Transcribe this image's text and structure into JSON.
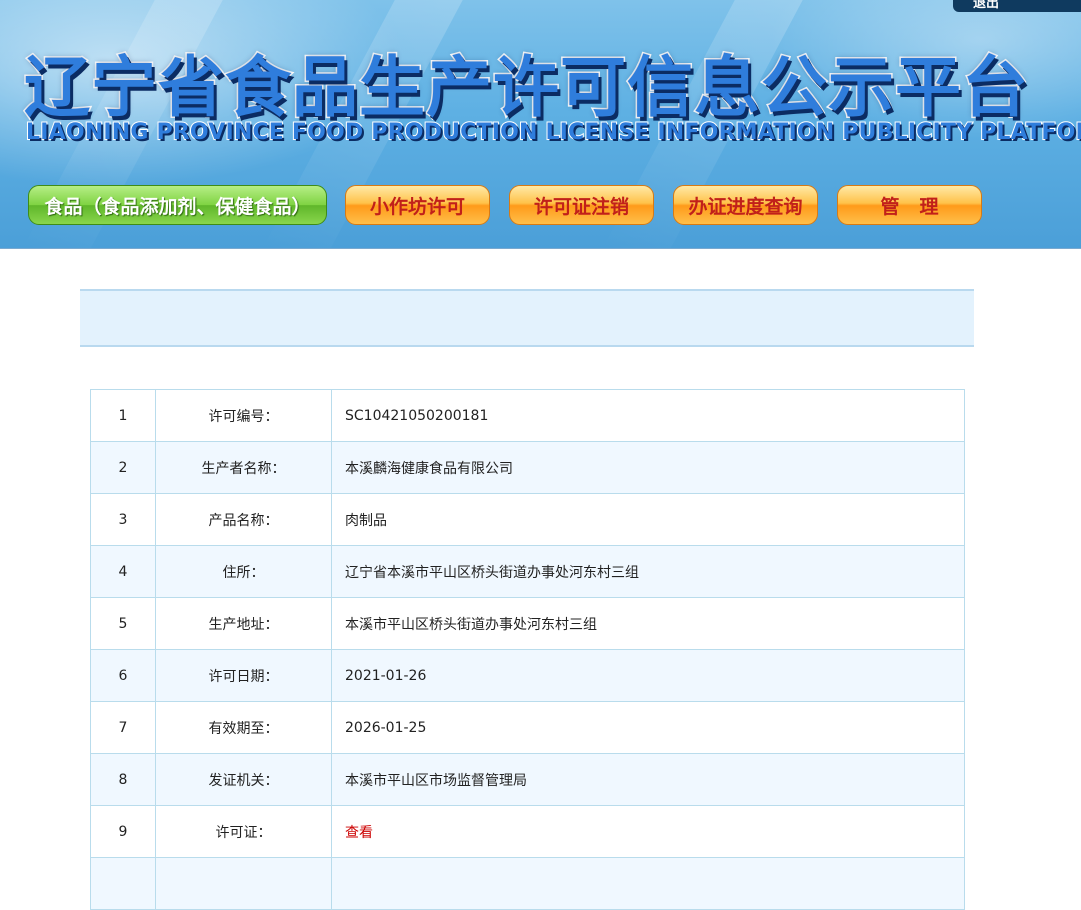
{
  "header": {
    "corner_text": "退出",
    "title": "辽宁省食品生产许可信息公示平台",
    "subtitle": "LIAONING PROVINCE FOOD PRODUCTION LICENSE INFORMATION PUBLICITY PLATFORM"
  },
  "nav": [
    {
      "label": "食品（食品添加剂、保健食品）"
    },
    {
      "label": "小作坊许可"
    },
    {
      "label": "许可证注销"
    },
    {
      "label": "办证进度查询"
    },
    {
      "label": "管理"
    }
  ],
  "colors": {
    "banner": "#5eb0e3",
    "nav_green": "#7fd342",
    "nav_orange": "#ffb233",
    "nav_orange_text": "#c1201a",
    "info_bar": "#e3f2fd",
    "table_border": "#b9dcec",
    "row_alt": "#f0f8ff",
    "link": "#cc0000"
  },
  "table": {
    "rows": [
      {
        "index": "1",
        "label": "许可编号：",
        "value": "SC10421050200181"
      },
      {
        "index": "2",
        "label": "生产者名称：",
        "value": "本溪麟海健康食品有限公司"
      },
      {
        "index": "3",
        "label": "产品名称：",
        "value": "肉制品"
      },
      {
        "index": "4",
        "label": "住所：",
        "value": "辽宁省本溪市平山区桥头街道办事处河东村三组"
      },
      {
        "index": "5",
        "label": "生产地址：",
        "value": "本溪市平山区桥头街道办事处河东村三组"
      },
      {
        "index": "6",
        "label": "许可日期：",
        "value": "2021-01-26"
      },
      {
        "index": "7",
        "label": "有效期至：",
        "value": "2026-01-25"
      },
      {
        "index": "8",
        "label": "发证机关：",
        "value": "本溪市平山区市场监督管理局"
      },
      {
        "index": "9",
        "label": "许可证：",
        "value": "查看"
      },
      {
        "index": "",
        "label": "",
        "value": ""
      }
    ]
  }
}
